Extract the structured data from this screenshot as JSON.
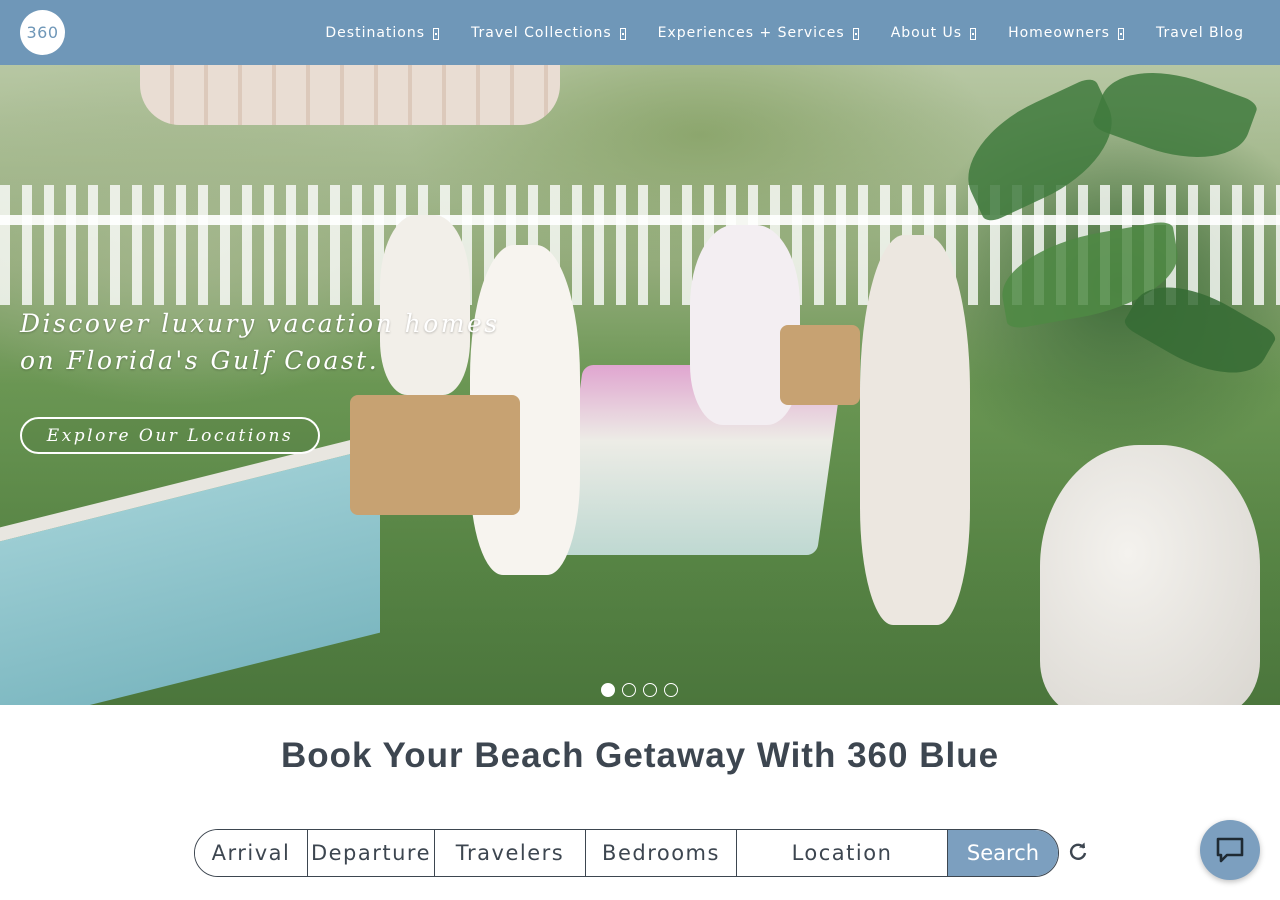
{
  "header": {
    "logo_text": "360",
    "nav": [
      {
        "label": "Destinations",
        "has_dropdown": true
      },
      {
        "label": "Travel Collections",
        "has_dropdown": true
      },
      {
        "label": "Experiences + Services",
        "has_dropdown": true
      },
      {
        "label": "About Us",
        "has_dropdown": true
      },
      {
        "label": "Homeowners",
        "has_dropdown": true
      },
      {
        "label": "Travel Blog",
        "has_dropdown": false
      }
    ]
  },
  "hero": {
    "headline": "Discover luxury vacation homes on Florida's Gulf Coast.",
    "cta_label": "Explore Our Locations",
    "slides_total": 4,
    "active_slide": 1
  },
  "booking": {
    "title": "Book Your Beach Getaway With 360 Blue",
    "fields": {
      "arrival": "Arrival",
      "departure": "Departure",
      "travelers": "Travelers",
      "bedrooms": "Bedrooms",
      "location": "Location"
    },
    "search_label": "Search",
    "reset_icon": "refresh-icon"
  },
  "chat": {
    "icon": "chat-icon"
  },
  "colors": {
    "header_bg": "#6f97b8",
    "accent": "#7c9fbf",
    "text": "#3d4650"
  }
}
